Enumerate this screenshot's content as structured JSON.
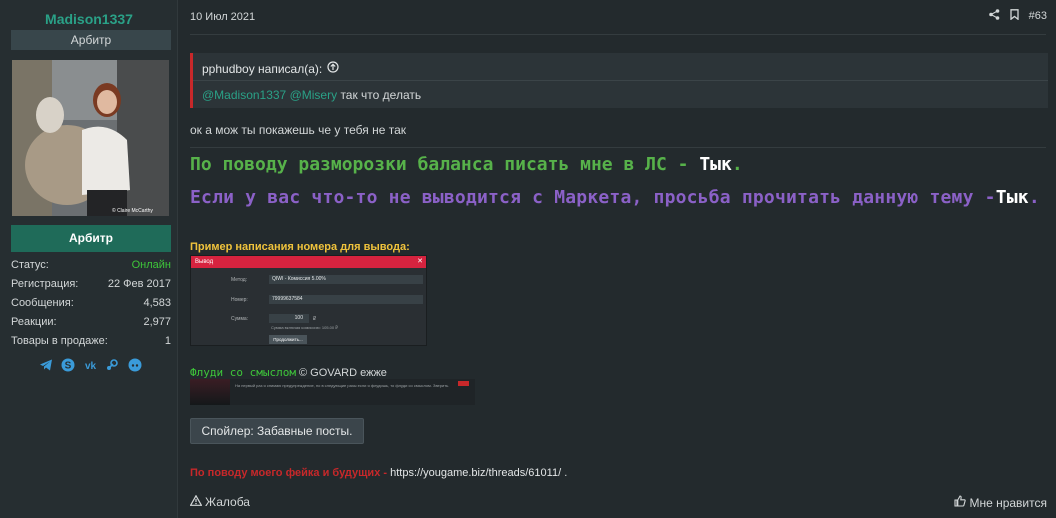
{
  "user": {
    "name": "Madison1337",
    "title": "Арбитр",
    "role_button": "Арбитр",
    "avatar_caption": "© Claire McCarthy",
    "stats": [
      {
        "key": "Статус:",
        "value": "Онлайн"
      },
      {
        "key": "Регистрация:",
        "value": "22 Фев 2017"
      },
      {
        "key": "Сообщения:",
        "value": "4,583"
      },
      {
        "key": "Реакции:",
        "value": "2,977"
      },
      {
        "key": "Товары в продаже:",
        "value": "1"
      }
    ],
    "socials": [
      "telegram-icon",
      "skype-icon",
      "vk-icon",
      "steam-icon",
      "discord-icon"
    ]
  },
  "post": {
    "date": "10 Июл 2021",
    "number": "#63",
    "quote": {
      "author": "pphudboy написал(а):",
      "mention1": "@Madison1337",
      "mention2": "@Misery",
      "text": "так что делать"
    },
    "reply": "ок а мож ты покажешь че у тебя не так",
    "signature": {
      "line1": "По поводу разморозки баланса писать мне в ЛС - ",
      "line1_link": "Тык",
      "line1_end": ".",
      "line2": "Если у вас что-то не выводится с Маркета, просьба прочитать данную тему -",
      "line2_link": "Тык",
      "line2_end": ".",
      "example_label": "Пример написания номера для вывода:",
      "mini_window": {
        "title": "Вывод",
        "method_label": "Метод:",
        "method_value": "QIWI - Комиссия 5.00%",
        "number_label": "Номер:",
        "number_value": "79999637584",
        "amount_label": "Сумма:",
        "amount_value": "100",
        "currency": "₽",
        "note": "Сумма включая комиссию: 105.00 ₽",
        "button": "Продолжить..."
      },
      "floods_green": "Флуди со смыслом",
      "floods_rest": " © GOVARD ежже",
      "banner_text": "На первый раз я снимаю предупреждение, но в следующие разы если я флудишь, то флуди со смыслом. Зверить.",
      "spoiler": "Спойлер: Забавные посты.",
      "fake_red": "По поводу моего фейка и будущих -",
      "fake_link": "https://yougame.biz/threads/61011/",
      "fake_end": "."
    },
    "actions": {
      "report": "Жалоба",
      "like": "Мне нравится"
    }
  }
}
